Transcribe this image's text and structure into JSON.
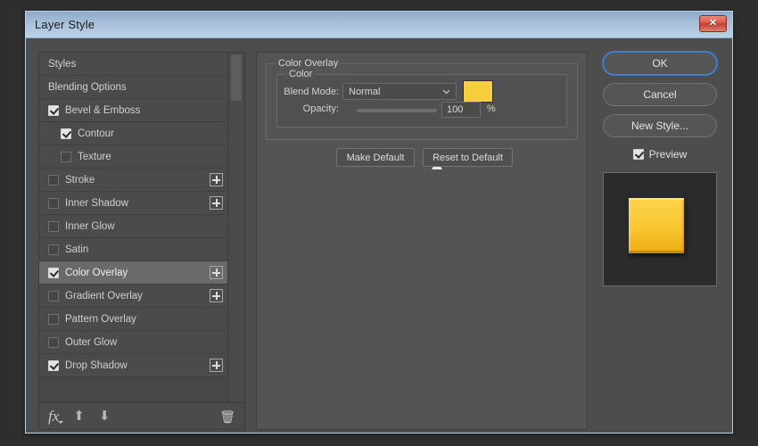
{
  "window": {
    "title": "Layer Style",
    "close_label": "✕"
  },
  "styles_panel": {
    "scrollbar": "vertical-scrollbar",
    "items": [
      {
        "label": "Styles",
        "type": "header",
        "checked": null,
        "indent": false,
        "selected": false,
        "plus": false
      },
      {
        "label": "Blending Options",
        "type": "header",
        "checked": null,
        "indent": false,
        "selected": false,
        "plus": false
      },
      {
        "label": "Bevel & Emboss",
        "type": "effect",
        "checked": true,
        "indent": false,
        "selected": false,
        "plus": false
      },
      {
        "label": "Contour",
        "type": "effect",
        "checked": true,
        "indent": true,
        "selected": false,
        "plus": false
      },
      {
        "label": "Texture",
        "type": "effect",
        "checked": false,
        "indent": true,
        "selected": false,
        "plus": false
      },
      {
        "label": "Stroke",
        "type": "effect",
        "checked": false,
        "indent": false,
        "selected": false,
        "plus": true
      },
      {
        "label": "Inner Shadow",
        "type": "effect",
        "checked": false,
        "indent": false,
        "selected": false,
        "plus": true
      },
      {
        "label": "Inner Glow",
        "type": "effect",
        "checked": false,
        "indent": false,
        "selected": false,
        "plus": false
      },
      {
        "label": "Satin",
        "type": "effect",
        "checked": false,
        "indent": false,
        "selected": false,
        "plus": false
      },
      {
        "label": "Color Overlay",
        "type": "effect",
        "checked": true,
        "indent": false,
        "selected": true,
        "plus": true
      },
      {
        "label": "Gradient Overlay",
        "type": "effect",
        "checked": false,
        "indent": false,
        "selected": false,
        "plus": true
      },
      {
        "label": "Pattern Overlay",
        "type": "effect",
        "checked": false,
        "indent": false,
        "selected": false,
        "plus": false
      },
      {
        "label": "Outer Glow",
        "type": "effect",
        "checked": false,
        "indent": false,
        "selected": false,
        "plus": false
      },
      {
        "label": "Drop Shadow",
        "type": "effect",
        "checked": true,
        "indent": false,
        "selected": false,
        "plus": true
      }
    ],
    "toolbar": {
      "fx_label": "fx",
      "move_up": "⬆",
      "move_down": "⬇",
      "delete": "🗑"
    }
  },
  "main_panel": {
    "section_title": "Color Overlay",
    "group_title": "Color",
    "blend_mode_label": "Blend Mode:",
    "blend_mode_value": "Normal",
    "blend_mode_options": [
      "Normal"
    ],
    "color_swatch_hex": "#F5CE3E",
    "opacity_label": "Opacity:",
    "opacity_value": "100",
    "opacity_unit": "%",
    "opacity_percent": 100,
    "make_default_label": "Make Default",
    "reset_default_label": "Reset to Default"
  },
  "right_column": {
    "ok_label": "OK",
    "cancel_label": "Cancel",
    "new_style_label": "New Style...",
    "preview_label": "Preview",
    "preview_checked": true,
    "preview_swatch_hex": "#F9C731",
    "preview_bg_hex": "#2B2B2B"
  },
  "colors": {
    "accent_focus": "#3F7FD0",
    "titlebar_top": "#8FABC9",
    "titlebar_bottom": "#BDD0E6",
    "window_bg": "#4D4D4D",
    "panel_bg": "#545454",
    "close_button": "#C13F2E"
  }
}
